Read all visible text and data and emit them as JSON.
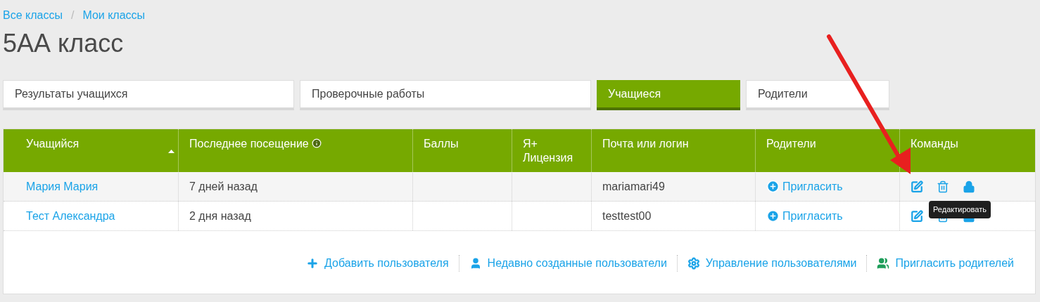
{
  "breadcrumbs": [
    "Все классы",
    "Мои классы"
  ],
  "breadcrumb_separator": "/",
  "title": "5АА класс",
  "tabs": [
    {
      "label": "Результаты учащихся",
      "selected": false
    },
    {
      "label": "Проверочные работы",
      "selected": false
    },
    {
      "label": "Учащиеся",
      "selected": true
    },
    {
      "label": "Родители",
      "selected": false
    }
  ],
  "table": {
    "columns": [
      {
        "label": "Учащийся",
        "sorted": true,
        "info": false
      },
      {
        "label": "Последнее посещение",
        "sorted": false,
        "info": true
      },
      {
        "label": "Баллы",
        "sorted": false,
        "info": false
      },
      {
        "label": "Я+ Лицензия",
        "sorted": false,
        "info": false
      },
      {
        "label": "Почта или логин",
        "sorted": false,
        "info": false
      },
      {
        "label": "Родители",
        "sorted": false,
        "info": false
      },
      {
        "label": "Команды",
        "sorted": false,
        "info": false
      }
    ],
    "rows": [
      {
        "name": "Мария Мария",
        "last_visit": "7 дней назад",
        "login": "mariamari49",
        "parents": "Пригласить"
      },
      {
        "name": "Тест Александра",
        "last_visit": "2 дня назад",
        "login": "testtest00",
        "parents": "Пригласить"
      }
    ]
  },
  "tooltip": "Редактировать",
  "actions": [
    {
      "kind": "add",
      "label": "Добавить пользователя"
    },
    {
      "kind": "user",
      "label": "Недавно созданные пользователи"
    },
    {
      "kind": "settings",
      "label": "Управление пользователями"
    },
    {
      "kind": "parents",
      "label": "Пригласить родителей"
    }
  ]
}
